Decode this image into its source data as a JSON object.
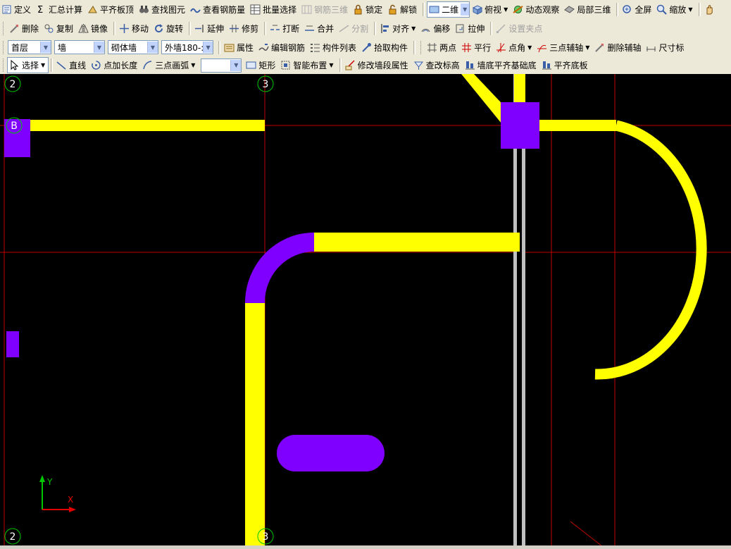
{
  "toolbar1": {
    "define": "定义",
    "sum_calc": "汇总计算",
    "flush_slab_top": "平齐板顶",
    "find_element": "查找图元",
    "view_rebar_qty": "查看钢筋量",
    "batch_select": "批量选择",
    "rebar_3d": "钢筋三维",
    "lock": "锁定",
    "unlock": "解锁",
    "view_mode": "二维",
    "top_view": "俯视",
    "dynamic_view": "动态观察",
    "local_3d": "局部三维",
    "fullscreen": "全屏",
    "zoom": "缩放"
  },
  "toolbar2": {
    "delete": "删除",
    "copy": "复制",
    "mirror": "镜像",
    "move": "移动",
    "rotate": "旋转",
    "extend": "延伸",
    "trim": "修剪",
    "break": "打断",
    "merge": "合并",
    "split": "分割",
    "align": "对齐",
    "offset": "偏移",
    "stretch": "拉伸",
    "set_grip": "设置夹点"
  },
  "toolbar3": {
    "floor_select": "首层",
    "type_select": "墙",
    "subtype_select": "砌体墙",
    "component_select": "外墙180-:",
    "properties": "属性",
    "edit_rebar": "编辑钢筋",
    "component_list": "构件列表",
    "pick_component": "拾取构件",
    "two_points": "两点",
    "parallel": "平行",
    "point_angle": "点角",
    "three_point_axis": "三点辅轴",
    "delete_axis": "删除辅轴",
    "dimension": "尺寸标"
  },
  "toolbar4": {
    "select": "选择",
    "line": "直线",
    "point_add_length": "点加长度",
    "three_point_arc": "三点画弧",
    "empty_select": "",
    "rectangle": "矩形",
    "smart_layout": "智能布置",
    "modify_wall_segment": "修改墙段属性",
    "check_elevation": "查改标高",
    "wall_bottom_flush": "墙底平齐基础底",
    "flush_slab_bottom": "平齐底板"
  },
  "canvas": {
    "axis_labels": {
      "top_2": "2",
      "top_3": "3",
      "left_B": "B",
      "bottom_2": "2",
      "bottom_3": "3"
    },
    "ucs": {
      "y": "Y",
      "x": "X"
    },
    "colors": {
      "wall": "#ffff00",
      "column": "#8000ff",
      "axis": "#c00000",
      "grey_wall": "#c0c0c0",
      "background": "#000000"
    }
  }
}
